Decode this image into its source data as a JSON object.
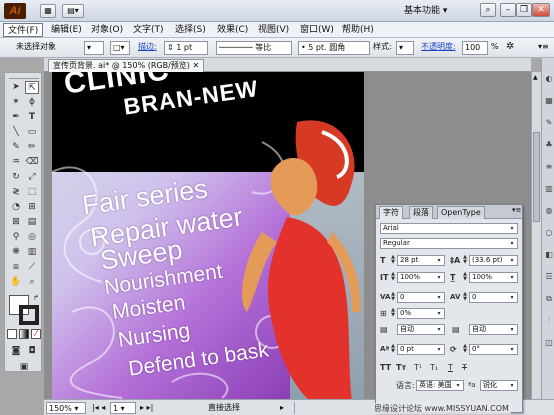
{
  "app": {
    "logo_text": "Ai",
    "workspace_label": "基本功能"
  },
  "menu": [
    "文件(F)",
    "编辑(E)",
    "对象(O)",
    "文字(T)",
    "选择(S)",
    "效果(C)",
    "视图(V)",
    "窗口(W)",
    "帮助(H)"
  ],
  "control": {
    "selection": "未选择对象",
    "stroke_link": "描边:",
    "stroke_value": "1 pt",
    "stroke_profile": "等比",
    "brush": "5 pt. 圆角",
    "style_label": "样式:",
    "opacity_link": "不透明度:",
    "opacity_value": "100",
    "opacity_unit": "%"
  },
  "document": {
    "tab_title": "宣传页背景. ai* @ 150% (RGB/预览)"
  },
  "artwork": {
    "brand_line1": "CLINIC",
    "brand_line2": "BRAN-NEW",
    "lines": [
      "Fair series",
      "Repair water",
      "Sweep",
      "Nourishment",
      "Moisten",
      "Nursing",
      "Defend to bask"
    ]
  },
  "status": {
    "zoom": "150%",
    "page": "1",
    "tool": "直接选择"
  },
  "character_panel": {
    "tabs": [
      "字符",
      "段落",
      "OpenType"
    ],
    "font_family": "Arial",
    "font_style": "Regular",
    "font_size": "28 pt",
    "leading": "(33.6 pt)",
    "horizontal_scale": "100%",
    "vertical_scale": "100%",
    "kerning": "0",
    "tracking": "0",
    "tsume": "0%",
    "aki_left": "自动",
    "aki_right": "自动",
    "baseline_shift": "0 pt",
    "rotation": "0°",
    "language_label": "语言:",
    "language": "英语: 美国",
    "antialias": "锐化"
  },
  "watermark": "思缘设计论坛  www.MISSYUAN.COM"
}
